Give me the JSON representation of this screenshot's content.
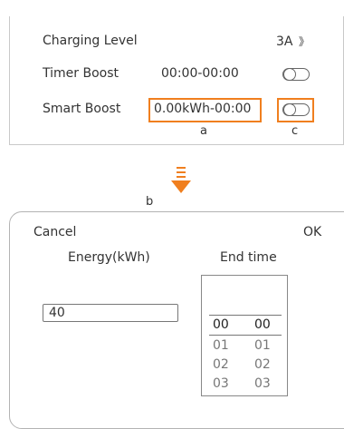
{
  "settings": {
    "charging_level": {
      "label": "Charging Level",
      "value": "3A",
      "chevron": "》"
    },
    "timer_boost": {
      "label": "Timer Boost",
      "value": "00:00-00:00",
      "enabled": false
    },
    "smart_boost": {
      "label": "Smart Boost",
      "value": "0.00kWh-00:00",
      "enabled": false
    }
  },
  "annotations": {
    "a": "a",
    "b": "b",
    "c": "c"
  },
  "accent_color": "#f07f1f",
  "dialog": {
    "cancel_label": "Cancel",
    "ok_label": "OK",
    "energy_label": "Energy(kWh)",
    "energy_value": "40",
    "end_time_label": "End time",
    "picker": {
      "selected_hour": "00",
      "selected_minute": "00",
      "rows": [
        {
          "hour": "01",
          "minute": "01"
        },
        {
          "hour": "02",
          "minute": "02"
        },
        {
          "hour": "03",
          "minute": "03"
        }
      ]
    }
  },
  "icons": {
    "arrow": "down-arrow-icon",
    "toggle": "toggle-switch-icon"
  }
}
